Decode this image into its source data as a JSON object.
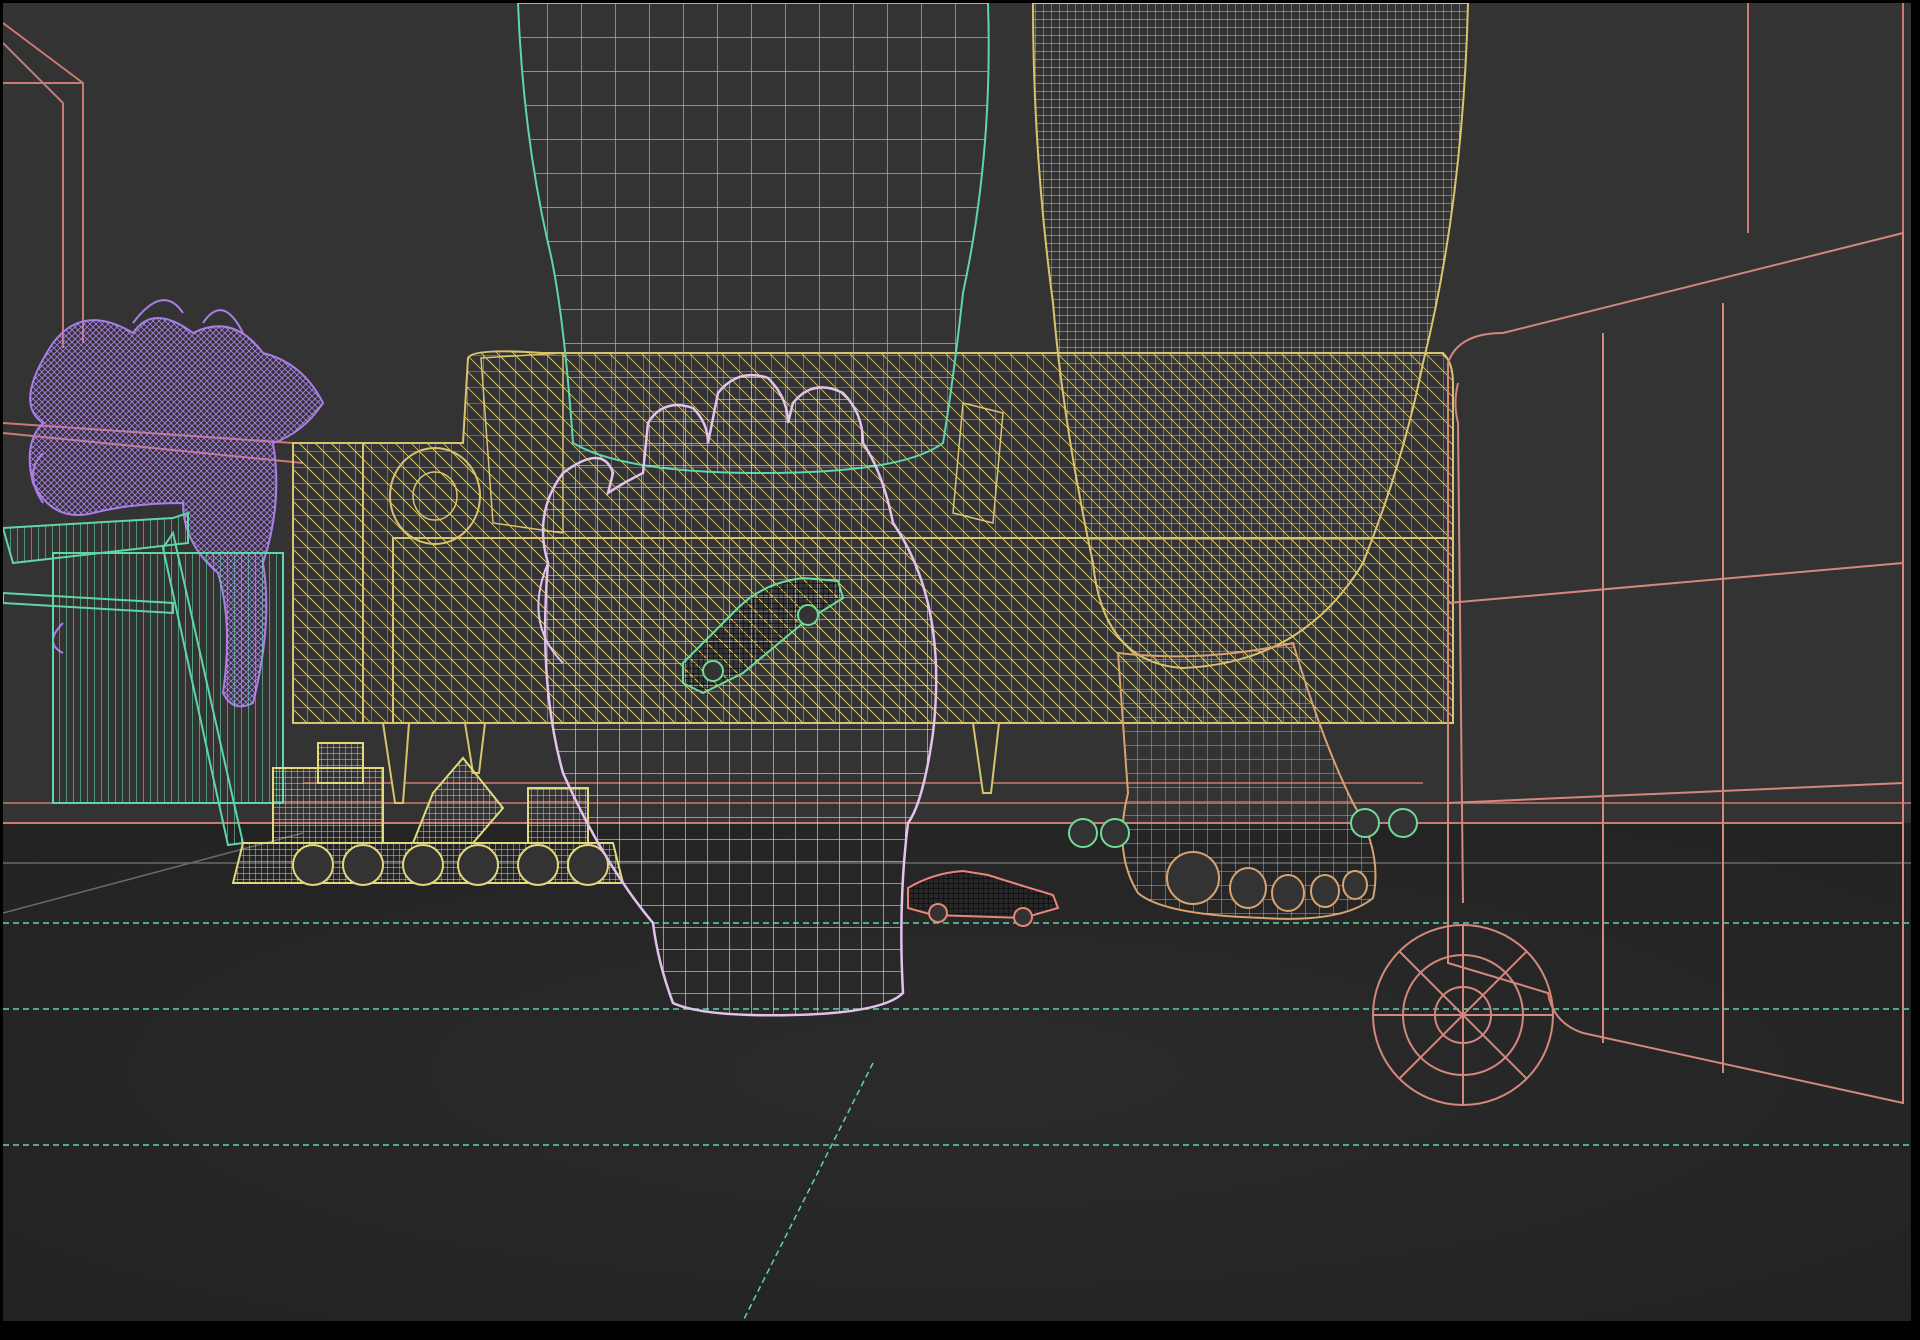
{
  "viewport": {
    "mode": "wireframe",
    "background_color": "#333333",
    "floor_color": "#272727",
    "frame_color": "#000000"
  },
  "scene": {
    "objects": [
      {
        "name": "room-wall-frame",
        "color": "#c97a72"
      },
      {
        "name": "floor-guide-lines",
        "color": "#5fd6a6"
      },
      {
        "name": "left-leg-pants",
        "color": "#5fd6a6"
      },
      {
        "name": "right-leg-pants",
        "color": "#d8c46a"
      },
      {
        "name": "sofa",
        "color": "#d8c46a"
      },
      {
        "name": "potted-plant",
        "color": "#a97ee6"
      },
      {
        "name": "side-table",
        "color": "#5fd6a6"
      },
      {
        "name": "hand",
        "color": "#e3c2ec"
      },
      {
        "name": "toy-car-in-hand",
        "color": "#6fdc96"
      },
      {
        "name": "toy-car-on-floor",
        "color": "#e8867a"
      },
      {
        "name": "toy-car-behind",
        "color": "#6fdc96"
      },
      {
        "name": "toy-train",
        "color": "#e2d97a"
      },
      {
        "name": "bare-foot",
        "color": "#d8a36f"
      },
      {
        "name": "luggage-case",
        "color": "#d4877c"
      }
    ]
  }
}
